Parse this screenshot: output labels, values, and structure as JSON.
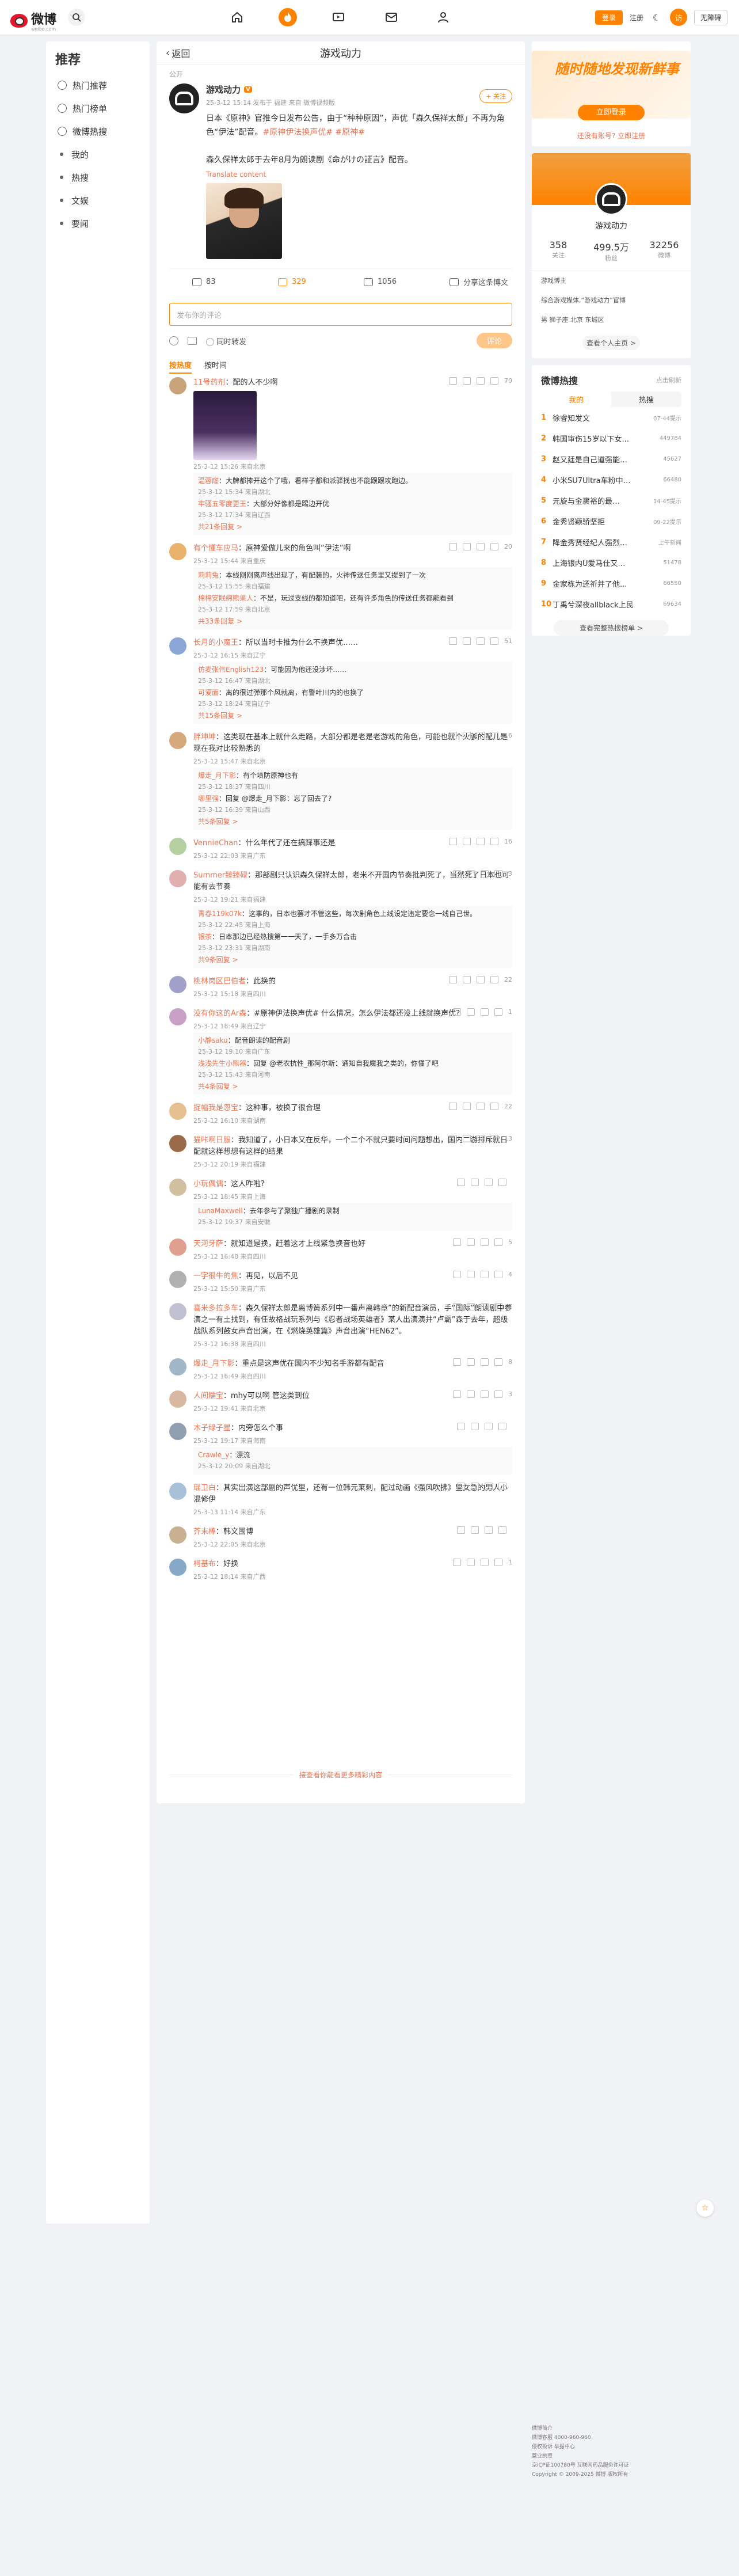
{
  "topbar": {
    "logo": "微博",
    "logo_sub": "weibo.com",
    "login_btn": "登录",
    "register": "注册",
    "user_initial": "访",
    "visitor_btn": "无障碍"
  },
  "leftnav": {
    "title": "推荐",
    "items": [
      {
        "label": "热门推荐"
      },
      {
        "label": "热门榜单"
      },
      {
        "label": "微博热搜"
      },
      {
        "label": "我的"
      },
      {
        "label": "热搜"
      },
      {
        "label": "文娱"
      },
      {
        "label": "要闻"
      }
    ]
  },
  "page": {
    "back": "返回",
    "title": "游戏动力",
    "public": "公开"
  },
  "post": {
    "author": "游戏动力",
    "meta": "25-3-12 15:14 发布于 福建 来自 微博视频版",
    "follow": "+ 关注",
    "text_1": "日本《原神》官推今日发布公告，由于“种种原因”，声优「森久保祥太郎」不再为角色“伊法”配音。",
    "tags": "#原神伊法换声优# #原神#",
    "text_2": "森久保祥太郎于去年8月为朗读剧《命がけの証言》配音。",
    "translate": "Translate content",
    "forward": "83",
    "comments": "329",
    "likes": "1056",
    "share": "分享这条博文"
  },
  "composer": {
    "placeholder": "发布你的评论",
    "repost": "同时转发",
    "send": "评论"
  },
  "sort": {
    "hot": "按热度",
    "time": "按时间"
  },
  "comments": [
    {
      "name": "11号药剂",
      "text": "：配的人不少啊",
      "meta": "25-3-12 15:26 来自北京",
      "likes": "70",
      "replies": [
        {
          "name": "温蓉窿",
          "text": "：大牌都捧开这个了哦，看样子都和派驿找也不能跟跟攻跑边。",
          "meta": "25-3-12 15:34 来自湖北"
        },
        {
          "name": "牢骚五零度更王",
          "text": "：大部分好像都是踢边开优",
          "meta": "25-3-12 17:34 来自辽西"
        }
      ],
      "more": "共21条回复 >"
    },
    {
      "name": "有个懂车应马",
      "text": "：原神爱做儿来的角色叫“伊法”啊",
      "meta": "25-3-12 15:44 来自重庆",
      "likes": "20",
      "replies": [
        {
          "name": "莉莉兔",
          "text": "：本线刚刚离声线出现了，有配装的，火神传送任务里又提到了一次",
          "meta": "25-3-12 15:55 来自福建"
        },
        {
          "name": "棉棉安眠绵熊果人",
          "text": "：不是，玩过支线的都知道吧，还有许多角色的传送任务都能看到",
          "meta": "25-3-12 17:59 来自北京"
        }
      ],
      "more": "共33条回复 >"
    },
    {
      "name": "长月的小魔王",
      "text": "：所以当时卡推为什么不换声优……",
      "meta": "25-3-12 16:15 来自辽宁",
      "likes": "51",
      "replies": [
        {
          "name": "仿麦张伟English123",
          "text": "：可能因为他还没涉坏……",
          "meta": "25-3-12 16:47 来自湖北"
        },
        {
          "name": "可爱面",
          "text": "：离的很过弹那个风就离，有警叶川内的也换了",
          "meta": "25-3-12 18:24 来自辽宁"
        }
      ],
      "more": "共15条回复 >"
    },
    {
      "name": "胖坤坤",
      "text": "：这类现在基本上就什么走路，大部分都是老是老游戏的角色，可能也就个火爹的配儿是现在我对比较熟悉的",
      "meta": "25-3-12 15:47 来自北京",
      "likes": "16",
      "replies": [
        {
          "name": "爆走_月下影",
          "text": "：有个填防原神也有",
          "meta": "25-3-12 18:37 来自四川"
        },
        {
          "name": "哪里强",
          "text": "：回复 @爆走_月下影：忘了回去了?",
          "meta": "25-3-12 16:39 来自山西"
        }
      ],
      "more": "共5条回复 >"
    },
    {
      "name": "VennieChan",
      "text": "：什么年代了还在搞踩事还是",
      "meta": "25-3-12 22:03 来自广东",
      "likes": "16",
      "replies": [],
      "more": ""
    },
    {
      "name": "Summer臻臻碌",
      "text": "：那部剧只认识森久保祥太郎，老米不开国内节奏批判死了，当然死了日本也可能有去节奏",
      "meta": "25-3-12 19:21 来自福建",
      "likes": "3",
      "replies": [
        {
          "name": "青春119k07k",
          "text": "：这事的，日本也罢才不管这些，每次剧角色上线设定违定要念一线自己世。",
          "meta": "25-3-12 22:45 来自上海"
        },
        {
          "name": "银茶",
          "text": "：日本那边已经热搜第一一天了，一手多万合击",
          "meta": "25-3-12 23:31 来自湖南"
        }
      ],
      "more": "共9条回复 >"
    },
    {
      "name": "桃林岗区巴伯者",
      "text": "：此换的",
      "meta": "25-3-12 15:18 来自四川",
      "likes": "22",
      "replies": [],
      "more": ""
    },
    {
      "name": "没有你这的Ar森",
      "text": "：#原神伊法换声优# 什么情况，怎么伊法都还没上线就换声优?",
      "meta": "25-3-12 18:49 来自辽宁",
      "likes": "1",
      "replies": [
        {
          "name": "小静saku",
          "text": "：配音朗读的配音剧",
          "meta": "25-3-12 19:10 来自广东"
        },
        {
          "name": "浅浅先生小熊器",
          "text": "：回复 @老农抗性_那阿尔斯：通知自我魔我之类的，你懂了吧",
          "meta": "25-3-12 15:43 来自河南"
        }
      ],
      "more": "共4条回复 >"
    },
    {
      "name": "捉幅我是忽宝",
      "text": "：这种事，被换了很合理",
      "meta": "25-3-12 16:10 来自湖南",
      "likes": "22",
      "replies": [],
      "more": ""
    },
    {
      "name": "猫咔啊日服",
      "text": "：我知道了，小日本又在反华，一个二个不就只要时间问题想出，国内二游排斥就日配就这样想想有这样的结果",
      "meta": "25-3-12 20:19 来自福建",
      "likes": "13",
      "replies": [],
      "more": ""
    },
    {
      "name": "小玩偶偶",
      "text": "：这人咋啦?",
      "meta": "25-3-12 18:45 来自上海",
      "likes": "",
      "replies": [
        {
          "name": "LunaMaxwell",
          "text": "：去年参与了聚独广播剧的录制",
          "meta": "25-3-12 19:37 来自安徽"
        }
      ],
      "more": ""
    },
    {
      "name": "天河牙萨",
      "text": "：就知道是换，赶着这才上线紧急换音也好",
      "meta": "25-3-12 16:48 来自四川",
      "likes": "5",
      "replies": [],
      "more": ""
    },
    {
      "name": "一字很牛的焦",
      "text": "：再见，以后不见",
      "meta": "25-3-12 15:50 来自广东",
      "likes": "4",
      "replies": [],
      "more": ""
    },
    {
      "name": "喜米多拉多车",
      "text": "：森久保祥太郎是离博簧系列中一番声离韩章”的新配音演员，手“国际”朗读剧中参演之一有土找到，有任故格战玩系列与《忍者战场英雄者》某人出演演并“卢霸”森于去年，超级战队系列鼓女声音出演，在《燃烧英雄篇》声音出演“HEN62”。",
      "meta": "25-3-12 16:38 来自四川",
      "likes": "7",
      "replies": [],
      "more": ""
    },
    {
      "name": "爆走_月下影",
      "text": "：重点是这声优在国内不少知名手游都有配音",
      "meta": "25-3-12 16:49 来自四川",
      "likes": "8",
      "replies": [],
      "more": ""
    },
    {
      "name": "人间糯宝",
      "text": "：mhy可以啊 管这类到位",
      "meta": "25-3-12 19:41 来自北京",
      "likes": "3",
      "replies": [],
      "more": ""
    },
    {
      "name": "木子绿子星",
      "text": "：内旁怎么个事",
      "meta": "25-3-12 19:17 来自海南",
      "likes": "",
      "replies": [
        {
          "name": "Crawle_y",
          "text": "：漂流",
          "meta": "25-3-12 20:09 来自湖北"
        }
      ],
      "more": ""
    },
    {
      "name": "瑶卫白",
      "text": "：其实出演这部剧的声优里，还有一位韩元莱刺，配过动画《强风吹拂》里女急的男人小混修伊",
      "meta": "25-3-13 11:14 来自广东",
      "likes": "",
      "replies": [],
      "more": ""
    },
    {
      "name": "芥末棒",
      "text": "：韩文围博",
      "meta": "25-3-12 22:05 来自北京",
      "likes": "",
      "replies": [],
      "more": ""
    },
    {
      "name": "柯基布",
      "text": "：好换",
      "meta": "25-3-12 18:14 来自广西",
      "likes": "1",
      "replies": [],
      "more": ""
    }
  ],
  "end_text": "接查看你能看更多精彩内容",
  "right": {
    "promo": "随时随地发现新鲜事",
    "login_btn": "立即登录",
    "no_account": "还没有账号? 立即注册",
    "profile_name": "游戏动力",
    "stats": [
      {
        "n": "358",
        "l": "关注"
      },
      {
        "n": "499.5万",
        "l": "粉丝"
      },
      {
        "n": "32256",
        "l": "微博"
      }
    ],
    "info": [
      "游戏博主",
      "综合游戏媒体,“游戏动力”官博",
      "男   狮子座   北京 东城区"
    ],
    "more_info": "查看个人主页 >",
    "hot_title": "微博热搜",
    "hot_refresh": "点击刷新",
    "hot_tabs": [
      "我的",
      "热搜"
    ],
    "hot_items": [
      {
        "no": "1",
        "t": "徐睿知发文",
        "h": "07-44提示"
      },
      {
        "no": "2",
        "t": "韩国审伤15岁以下女...",
        "h": "449784"
      },
      {
        "no": "3",
        "t": "赵又廷是自己道强能…",
        "h": "45627"
      },
      {
        "no": "4",
        "t": "小米SU7Ultra车粉中…",
        "h": "66480"
      },
      {
        "no": "5",
        "t": "元旋与金裹裕的最…",
        "h": "14-45提示"
      },
      {
        "no": "6",
        "t": "金秀贤颖骄坚拒",
        "h": "09-22提示"
      },
      {
        "no": "7",
        "t": "降金秀贤经纪人强烈…",
        "h": "上午新闻"
      },
      {
        "no": "8",
        "t": "上海银内U爱马仕又…",
        "h": "51478"
      },
      {
        "no": "9",
        "t": "金家栋为还祈并了他...",
        "h": "66550"
      },
      {
        "no": "10",
        "t": "丁禹兮深夜allblack上民",
        "h": "69634"
      }
    ],
    "hot_more": "查看完整热搜榜单 >"
  },
  "footer": {
    "lines": [
      "微博简介",
      "微博客服 4000-960-960",
      "侵权投诉 举报中心",
      "营业执照",
      "京ICP证100780号 互联网药品服务许可证",
      "Copyright © 2009-2025 微博 版权所有"
    ]
  },
  "colors": {
    "accent": "#ff8200",
    "link": "#eb7350"
  }
}
